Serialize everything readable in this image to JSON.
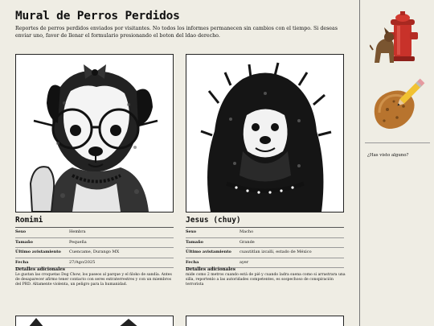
{
  "page": {
    "title": "Mural de Perros Perdidos",
    "subtitle": "Reportes de perros perdidos enviados por visitantes. No todos los informes permanecen sin cambios con el tiempo. Si deseas enviar uno, favor de llenar el formulario presionando el boton del ldao derecho."
  },
  "cards": [
    {
      "name": "Romimi",
      "image_icon": "dog-with-glasses-photo",
      "fields": [
        {
          "label": "Sexo",
          "value": "Hembra"
        },
        {
          "label": "Tamaño",
          "value": "Pequeña"
        },
        {
          "label": "Último avistamiento",
          "value": "Cuencame, Durango MX"
        },
        {
          "label": "Fecha",
          "value": "27/Ago/2025"
        }
      ],
      "details_title": "Detalles adicionales",
      "details": "Le gustan las croquetas Dog Chow, los paseos al parque y el ñloko de sandía. Antes de desaparecer afirmo tener contacto con seres extraterrestres y con un miembros del PRD. Altamente violenta, un peligro para la humanidad."
    },
    {
      "name": "Jesus (chuy)",
      "image_icon": "shaggy-dog-photo",
      "fields": [
        {
          "label": "Sexo",
          "value": "Macho"
        },
        {
          "label": "Tamaño",
          "value": "Grande"
        },
        {
          "label": "Último avistamiento",
          "value": "cuautitlan izcalli, estado de México"
        },
        {
          "label": "Fecha",
          "value": "ayer"
        }
      ],
      "details_title": "Detalles adicionales",
      "details": "mide como 2 metros cuando está de pié y cuando ladra suena como si arrastrara una silla, reportenlo a las autoridades competentes, es sospechoso de conspiración terrorista"
    }
  ],
  "sidebar": {
    "icons": [
      "dog-hydrant-icon",
      "potato-pencil-icon"
    ],
    "link": "¿Has visto alguno?"
  }
}
